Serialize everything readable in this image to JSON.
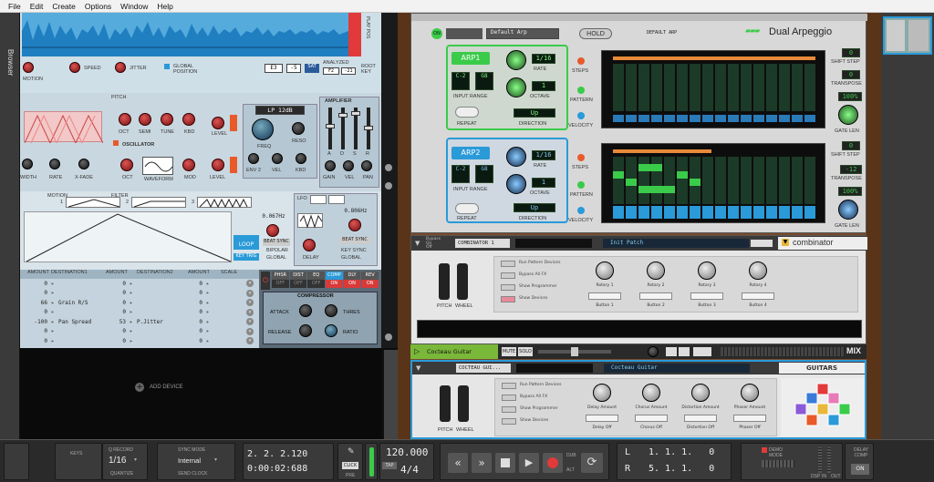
{
  "menu": [
    "File",
    "Edit",
    "Create",
    "Options",
    "Window",
    "Help"
  ],
  "browser_tab": "Browser",
  "sampler": {
    "top_labels": {
      "motion": "MOTION",
      "speed": "SPEED",
      "jitter": "JITTER",
      "global_position": "GLOBAL POSITION",
      "play_pos": "PLAY POS",
      "sat": "SAT",
      "analyzed": "ANALYZED",
      "root_key": "ROOT KEY"
    },
    "key_values": {
      "e3": "E3",
      "m5": "-5",
      "f2": "F2",
      "f21": "-21"
    },
    "pitch_label": "PITCH",
    "pitch_knobs": [
      "OCT",
      "SEMI",
      "TUNE",
      "KBD"
    ],
    "level_label": "LEVEL",
    "filter_label": "LP 12dB",
    "filter_knobs": [
      "FREQ",
      "RESO"
    ],
    "filter_knobs2": [
      "ENV 2",
      "VEL",
      "KBD"
    ],
    "amplifier_label": "AMPLIFIER",
    "amp_sliders": [
      "A",
      "D",
      "S",
      "R"
    ],
    "amp_knobs": [
      "GAIN",
      "VEL",
      "PAN"
    ],
    "oscillator_label": "OSCILLATOR",
    "osc_knobs": [
      "OCT",
      "WAVEFORM",
      "MOD",
      "LEVEL"
    ],
    "grain_knobs": [
      "WIDTH",
      "RATE",
      "X-FADE"
    ],
    "motion_tabs": {
      "motion": "MOTION",
      "filter": "FILTER",
      "n1": "1",
      "n2": "2",
      "n3": "3"
    },
    "lfo": {
      "label": "LFO",
      "rate1": "0.067Hz",
      "rate2": "0.806Hz",
      "loop": "LOOP",
      "beat_sync": "BEAT SYNC",
      "key_trig": "KEY TRIG",
      "bipolar": "BIPOLAR",
      "global": "GLOBAL",
      "delay": "DELAY",
      "key_sync": "KEY SYNC"
    },
    "mod_headers": [
      "AMOUNT",
      "DESTINATION1",
      "AMOUNT",
      "DESTINATION2",
      "AMOUNT",
      "SCALE"
    ],
    "mod_rows": [
      {
        "a1": "0",
        "d1": "",
        "a2": "0",
        "d2": "",
        "a3": "0"
      },
      {
        "a1": "0",
        "d1": "",
        "a2": "0",
        "d2": "",
        "a3": "0"
      },
      {
        "a1": "66",
        "d1": "Grain R/S",
        "a2": "0",
        "d2": "",
        "a3": "0"
      },
      {
        "a1": "0",
        "d1": "",
        "a2": "0",
        "d2": "",
        "a3": "0"
      },
      {
        "a1": "-100",
        "d1": "Pan Spread",
        "a2": "53",
        "d2": "P.Jitter",
        "a3": "0"
      },
      {
        "a1": "0",
        "d1": "",
        "a2": "0",
        "d2": "",
        "a3": "0"
      },
      {
        "a1": "0",
        "d1": "",
        "a2": "0",
        "d2": "",
        "a3": "0"
      }
    ],
    "fx_tabs": [
      "PHSR",
      "DIST",
      "EQ",
      "COMP",
      "DLY",
      "REV"
    ],
    "fx_states": [
      "OFF",
      "OFF",
      "OFF",
      "ON",
      "ON",
      "ON"
    ],
    "compressor": {
      "label": "COMPRESSOR",
      "attack": "ATTACK",
      "thres": "THRES",
      "release": "RELEASE",
      "ratio": "RATIO"
    }
  },
  "add_device": "ADD DEVICE",
  "arp": {
    "patch": "Default Arp",
    "hold": "HOLD",
    "patch_display": "DEFAULT ARP",
    "title": "Dual Arpeggio",
    "arp1": {
      "label": "ARP1",
      "rate": "1/16",
      "octave": "1",
      "range_lo": "C-2",
      "range_hi": "G8",
      "direction": "Up",
      "rate_lbl": "RATE",
      "octave_lbl": "OCTAVE",
      "input_range": "INPUT RANGE",
      "repeat": "REPEAT",
      "direction_lbl": "DIRECTION",
      "steps": "STEPS",
      "pattern": "PATTERN",
      "velocity": "VELOCITY",
      "shift_step": "0",
      "transpose": "0",
      "gate": "100%",
      "shift_lbl": "SHIFT STEP",
      "transpose_lbl": "TRANSPOSE",
      "gate_lbl": "GATE LEN",
      "lrn": "LRN"
    },
    "arp2": {
      "label": "ARP2",
      "rate": "1/16",
      "octave": "1",
      "range_lo": "C-2",
      "range_hi": "G8",
      "direction": "Up",
      "shift_step": "0",
      "transpose": "-12",
      "gate": "100%"
    }
  },
  "combinator1": {
    "name": "COMBINATOR 1",
    "patch": "Init Patch",
    "logo": "combinator",
    "bypass": "Bypass",
    "on": "On",
    "off": "Off",
    "btns": [
      "Run Pattern Devices",
      "Bypass All FX",
      "Show Programmer",
      "Show Devices"
    ],
    "rotaries": [
      "Rotary 1",
      "Rotary 2",
      "Rotary 3",
      "Rotary 4"
    ],
    "buttons": [
      "Button 1",
      "Button 2",
      "Button 3",
      "Button 4"
    ],
    "pitch": "PITCH",
    "wheel": "WHEEL"
  },
  "mixer_strip": {
    "track": "Cocteau Guitar",
    "mute": "MUTE",
    "solo": "SOLO",
    "mix": "MIX"
  },
  "combinator2": {
    "name": "COCTEAU GUI...",
    "patch": "Cocteau Guitar",
    "logo": "GUITARS",
    "btns": [
      "Run Pattern Devices",
      "Bypass All FX",
      "Show Programmer",
      "Show Devices"
    ],
    "knobs": [
      "Delay Amount",
      "Chorus Amount",
      "Distortion Amount",
      "Phaser Amount"
    ],
    "buttons": [
      "Delay Off",
      "Chorus Off",
      "Distortion Off",
      "Phaser Off"
    ]
  },
  "transport": {
    "keys": "KEYS",
    "q_record": "Q RECORD",
    "quantize_val": "1/16",
    "quantize": "QUANTIZE",
    "sync_mode": "SYNC MODE",
    "sync_val": "Internal",
    "send_clock": "SEND CLOCK",
    "position": "2. 2. 2.120",
    "time": "0:00:02:688",
    "pre": "PRE",
    "click": "CLICK",
    "tempo": "120.000",
    "tap": "TAP",
    "signature": "4/4",
    "dub": "DUB",
    "alt": "ALT",
    "loop_l": "L",
    "loop_l_val": "1. 1. 1.   0",
    "loop_r": "R",
    "loop_r_val": "5. 1. 1.   0",
    "demo_mode": "DEMO MODE",
    "dsp": "DSP",
    "in": "IN",
    "out": "OUT",
    "delay_comp": "DELAY COMP",
    "on": "ON"
  },
  "colors": {
    "accent_blue": "#2a9ad8",
    "arp_green": "#3acb4a",
    "rack_wood": "#7a4a2a"
  }
}
